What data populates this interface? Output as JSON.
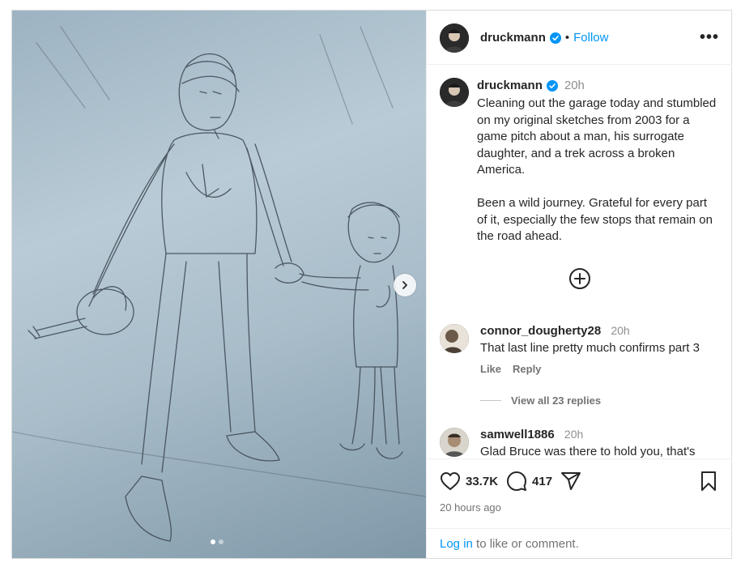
{
  "post": {
    "username": "druckmann",
    "follow_label": "Follow",
    "separator": "•",
    "more_label": "•••"
  },
  "caption": {
    "username": "druckmann",
    "time": "20h",
    "text": "Cleaning out the garage today and stumbled on my original sketches from 2003 for a game pitch about a man, his surrogate daughter, and a trek across a broken America.\n\nBeen a wild journey. Grateful for every part of it, especially the few stops that remain on the road ahead."
  },
  "comments": [
    {
      "username": "connor_dougherty28",
      "time": "20h",
      "text": "That last line pretty much confirms part 3",
      "like_label": "Like",
      "reply_label": "Reply",
      "replies_label": "View all 23 replies"
    },
    {
      "username": "samwell1886",
      "time": "20h",
      "text": "Glad Bruce was there to hold you, that's"
    }
  ],
  "stats": {
    "likes": "33.7K",
    "comments": "417",
    "posted_ago": "20 hours ago"
  },
  "login": {
    "link_label": "Log in",
    "rest_label": " to like or comment."
  },
  "carousel": {
    "count": 2,
    "active": 1
  },
  "colors": {
    "accent": "#0095f6",
    "verified": "#0095f6",
    "muted": "#737373"
  }
}
